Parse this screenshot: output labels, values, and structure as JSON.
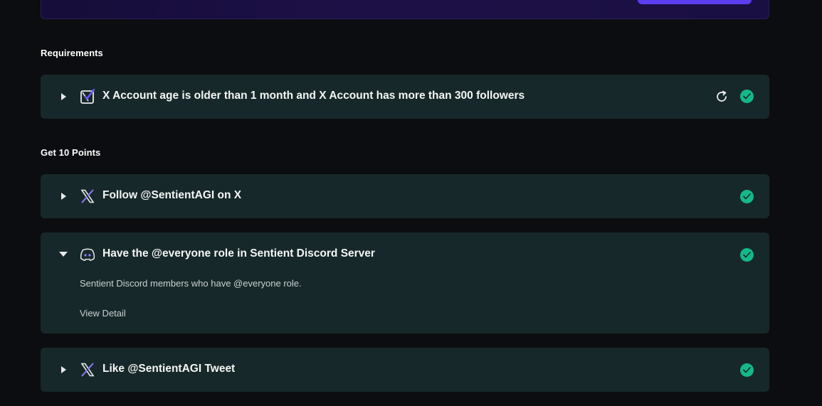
{
  "sections": {
    "requirements_heading": "Requirements",
    "points_heading": "Get 10 Points"
  },
  "requirements": [
    {
      "title": "X Account age is older than 1 month and X Account has more than 300 followers",
      "icon": "x-account-check-icon",
      "status": "completed"
    }
  ],
  "tasks": [
    {
      "title": "Follow @SentientAGI on X",
      "icon": "x-logo-icon",
      "status": "completed",
      "expanded": false
    },
    {
      "title": "Have the @everyone role in Sentient Discord Server",
      "icon": "discord-icon",
      "status": "completed",
      "expanded": true,
      "description": "Sentient Discord members who have @everyone role.",
      "link_label": "View Detail"
    },
    {
      "title": "Like @SentientAGI Tweet",
      "icon": "x-logo-icon",
      "status": "completed",
      "expanded": false
    }
  ],
  "colors": {
    "background": "#0c0d10",
    "card": "#17282a",
    "success": "#14b88a",
    "accent": "#5b3ef0"
  }
}
